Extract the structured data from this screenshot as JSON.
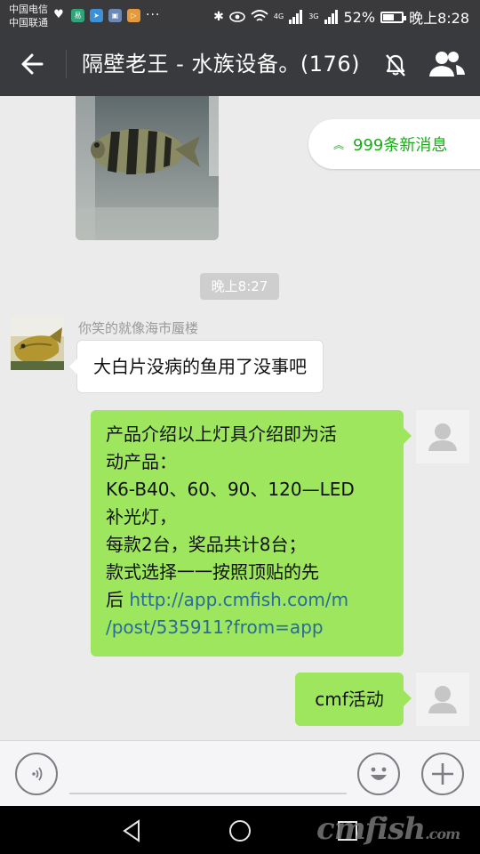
{
  "status_bar": {
    "carrier_1": "中国电信",
    "carrier_2": "中国联通",
    "battery": "52%",
    "battery_level": 0.52,
    "time": "晚上8:28",
    "signal_label": "4G",
    "signal_label_2": "3G"
  },
  "title_bar": {
    "title": "隔壁老王 - 水族设备。(176)",
    "icons": [
      "back-arrow-icon",
      "mute-bell-icon",
      "group-members-icon"
    ]
  },
  "chat": {
    "new_messages_label": "999条新消息",
    "timestamp": "晚上8:27",
    "messages": [
      {
        "side": "left",
        "sender": "你笑的就像海市蜃楼",
        "text": "大白片没病的鱼用了没事吧"
      },
      {
        "side": "right",
        "lines": [
          "产品介绍以上灯具介绍即为活",
          "动产品：",
          "K6-B40、60、90、120—LED",
          "补光灯，",
          "每款2台，奖品共计8台；",
          "款式选择一一按照顶贴的先"
        ],
        "link_prefix": "后 ",
        "link_line_1": "http://app.cmfish.com/m",
        "link_line_2": "/post/535911?from=app"
      },
      {
        "side": "right",
        "text": "cmf活动"
      }
    ]
  },
  "input_bar": {
    "placeholder": "",
    "icons": [
      "voice-icon",
      "emoji-icon",
      "plus-icon"
    ]
  },
  "nav_bar": {
    "watermark": "cmfish",
    "watermark_suffix": ".com",
    "icons": [
      "nav-back-icon",
      "nav-home-icon",
      "nav-recent-icon"
    ]
  }
}
